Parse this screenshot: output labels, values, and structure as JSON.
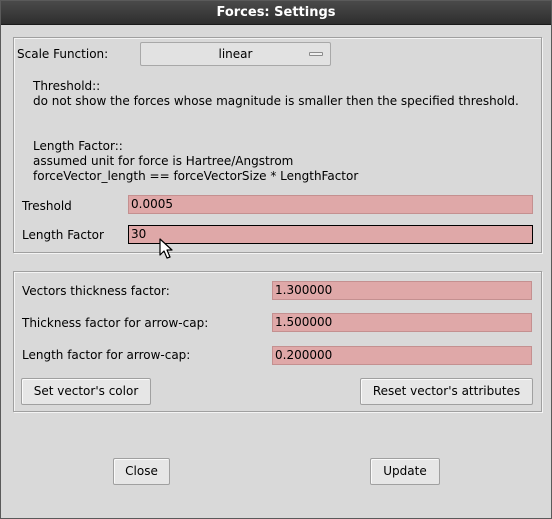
{
  "window": {
    "title": "Forces: Settings"
  },
  "scale": {
    "label": "Scale Function:",
    "selected": "linear",
    "threshold_heading": "Threshold::",
    "threshold_desc": "do not show the forces whose magnitude is smaller then the specified threshold.",
    "length_heading": "Length Factor::",
    "length_desc1": "assumed unit for force is Hartree/Angstrom",
    "length_desc2": "forceVector_length == forceVectorSize * LengthFactor",
    "treshold_label": "Treshold",
    "treshold_value": "0.0005",
    "length_factor_label": "Length Factor",
    "length_factor_value": "30"
  },
  "vectors": {
    "thickness_label": "Vectors thickness factor:",
    "thickness_value": "1.300000",
    "cap_thickness_label": "Thickness factor for arrow-cap:",
    "cap_thickness_value": "1.500000",
    "cap_length_label": "Length factor for arrow-cap:",
    "cap_length_value": "0.200000",
    "set_color_label": "Set vector's color",
    "reset_label": "Reset vector's attributes"
  },
  "buttons": {
    "close": "Close",
    "update": "Update"
  },
  "icons": {
    "dropdown": "dropdown-arrow-icon",
    "cursor": "mouse-pointer-icon"
  }
}
